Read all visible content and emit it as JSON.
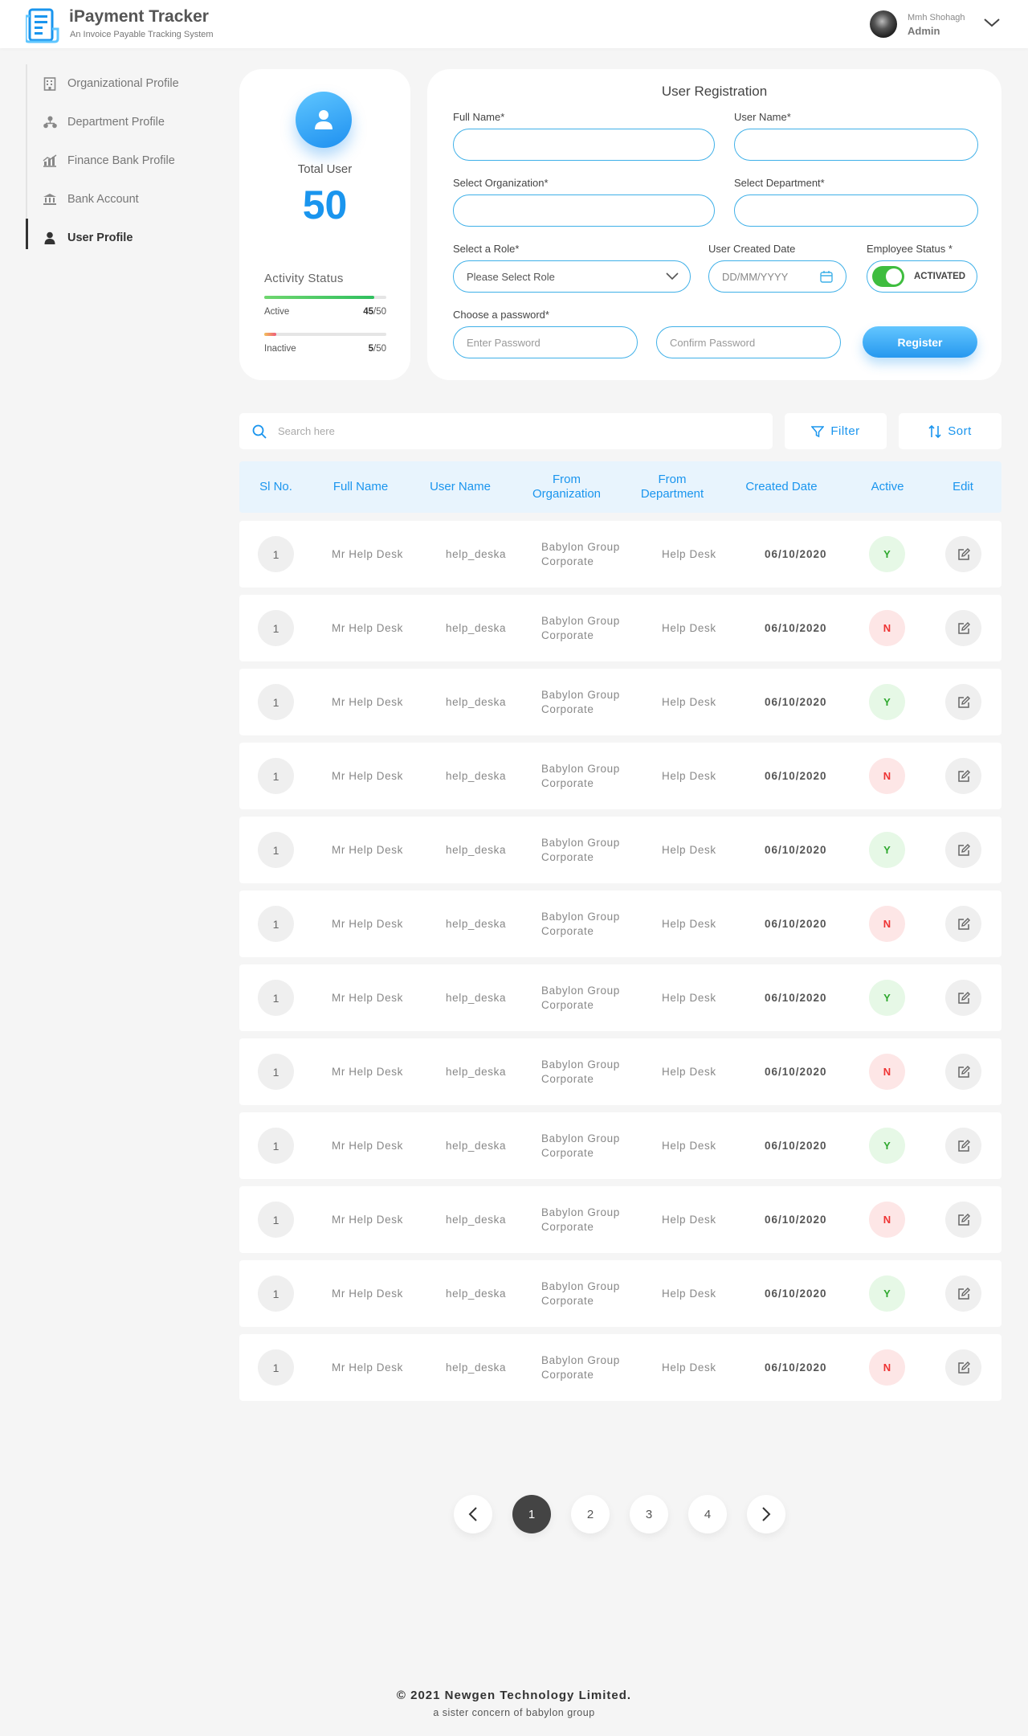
{
  "header": {
    "app_title": "iPayment Tracker",
    "app_subtitle": "An Invoice Payable Tracking System",
    "user_name": "Mmh Shohagh",
    "user_role": "Admin"
  },
  "sidebar": {
    "items": [
      {
        "label": "Organizational Profile",
        "icon": "building-icon"
      },
      {
        "label": "Department Profile",
        "icon": "org-chart-icon"
      },
      {
        "label": "Finance Bank Profile",
        "icon": "finance-chart-icon"
      },
      {
        "label": "Bank Account",
        "icon": "bank-icon"
      },
      {
        "label": "User Profile",
        "icon": "user-icon"
      }
    ],
    "active": "User Profile"
  },
  "stats": {
    "total_label": "Total User",
    "total_value": "50",
    "activity_title": "Activity Status",
    "active_label": "Active",
    "active_count": "45",
    "active_total": "/50",
    "active_fraction": 0.9,
    "inactive_label": "Inactive",
    "inactive_count": "5",
    "inactive_total": "/50",
    "inactive_fraction": 0.1
  },
  "registration": {
    "title": "User Registration",
    "full_name_label": "Full Name*",
    "user_name_label": "User Name*",
    "org_label": "Select Organization*",
    "dept_label": "Select Department*",
    "role_label": "Select a Role*",
    "role_placeholder": "Please Select Role",
    "date_label": "User Created Date",
    "date_placeholder": "DD/MM/YYYY",
    "status_label": "Employee Status *",
    "status_value": "ACTIVATED",
    "password_label": "Choose a password*",
    "password_placeholder": "Enter Password",
    "confirm_placeholder": "Confirm Password",
    "register_label": "Register"
  },
  "toolbar": {
    "search_placeholder": "Search here",
    "filter_label": "Filter",
    "sort_label": "Sort"
  },
  "table": {
    "headers": {
      "sl": "Sl No.",
      "full_name": "Full Name",
      "user_name": "User Name",
      "org_1": "From",
      "org_2": "Organization",
      "dept_1": "From",
      "dept_2": "Department",
      "created": "Created Date",
      "active": "Active",
      "edit": "Edit"
    },
    "rows": [
      {
        "sl": "1",
        "full_name": "Mr Help Desk",
        "user_name": "help_deska",
        "org_1": "Babylon Group",
        "org_2": "Corporate",
        "dept": "Help Desk",
        "date": "06/10/2020",
        "active": "Y"
      },
      {
        "sl": "1",
        "full_name": "Mr Help Desk",
        "user_name": "help_deska",
        "org_1": "Babylon Group",
        "org_2": "Corporate",
        "dept": "Help Desk",
        "date": "06/10/2020",
        "active": "N"
      },
      {
        "sl": "1",
        "full_name": "Mr Help Desk",
        "user_name": "help_deska",
        "org_1": "Babylon Group",
        "org_2": "Corporate",
        "dept": "Help Desk",
        "date": "06/10/2020",
        "active": "Y"
      },
      {
        "sl": "1",
        "full_name": "Mr Help Desk",
        "user_name": "help_deska",
        "org_1": "Babylon Group",
        "org_2": "Corporate",
        "dept": "Help Desk",
        "date": "06/10/2020",
        "active": "N"
      },
      {
        "sl": "1",
        "full_name": "Mr Help Desk",
        "user_name": "help_deska",
        "org_1": "Babylon Group",
        "org_2": "Corporate",
        "dept": "Help Desk",
        "date": "06/10/2020",
        "active": "Y"
      },
      {
        "sl": "1",
        "full_name": "Mr Help Desk",
        "user_name": "help_deska",
        "org_1": "Babylon Group",
        "org_2": "Corporate",
        "dept": "Help Desk",
        "date": "06/10/2020",
        "active": "N"
      },
      {
        "sl": "1",
        "full_name": "Mr Help Desk",
        "user_name": "help_deska",
        "org_1": "Babylon Group",
        "org_2": "Corporate",
        "dept": "Help Desk",
        "date": "06/10/2020",
        "active": "Y"
      },
      {
        "sl": "1",
        "full_name": "Mr Help Desk",
        "user_name": "help_deska",
        "org_1": "Babylon Group",
        "org_2": "Corporate",
        "dept": "Help Desk",
        "date": "06/10/2020",
        "active": "N"
      },
      {
        "sl": "1",
        "full_name": "Mr Help Desk",
        "user_name": "help_deska",
        "org_1": "Babylon Group",
        "org_2": "Corporate",
        "dept": "Help Desk",
        "date": "06/10/2020",
        "active": "Y"
      },
      {
        "sl": "1",
        "full_name": "Mr Help Desk",
        "user_name": "help_deska",
        "org_1": "Babylon Group",
        "org_2": "Corporate",
        "dept": "Help Desk",
        "date": "06/10/2020",
        "active": "N"
      },
      {
        "sl": "1",
        "full_name": "Mr Help Desk",
        "user_name": "help_deska",
        "org_1": "Babylon Group",
        "org_2": "Corporate",
        "dept": "Help Desk",
        "date": "06/10/2020",
        "active": "Y"
      },
      {
        "sl": "1",
        "full_name": "Mr Help Desk",
        "user_name": "help_deska",
        "org_1": "Babylon Group",
        "org_2": "Corporate",
        "dept": "Help Desk",
        "date": "06/10/2020",
        "active": "N"
      }
    ]
  },
  "pagination": {
    "pages": [
      "1",
      "2",
      "3",
      "4"
    ],
    "current": "1"
  },
  "footer": {
    "copyright": "© 2021 Newgen Technology Limited.",
    "tagline": "a sister concern of babylon group"
  },
  "colors": {
    "accent": "#1a95ee",
    "input_border": "#3fb0e8",
    "active_green": "#2ea82e",
    "inactive_red": "#ee3333"
  }
}
